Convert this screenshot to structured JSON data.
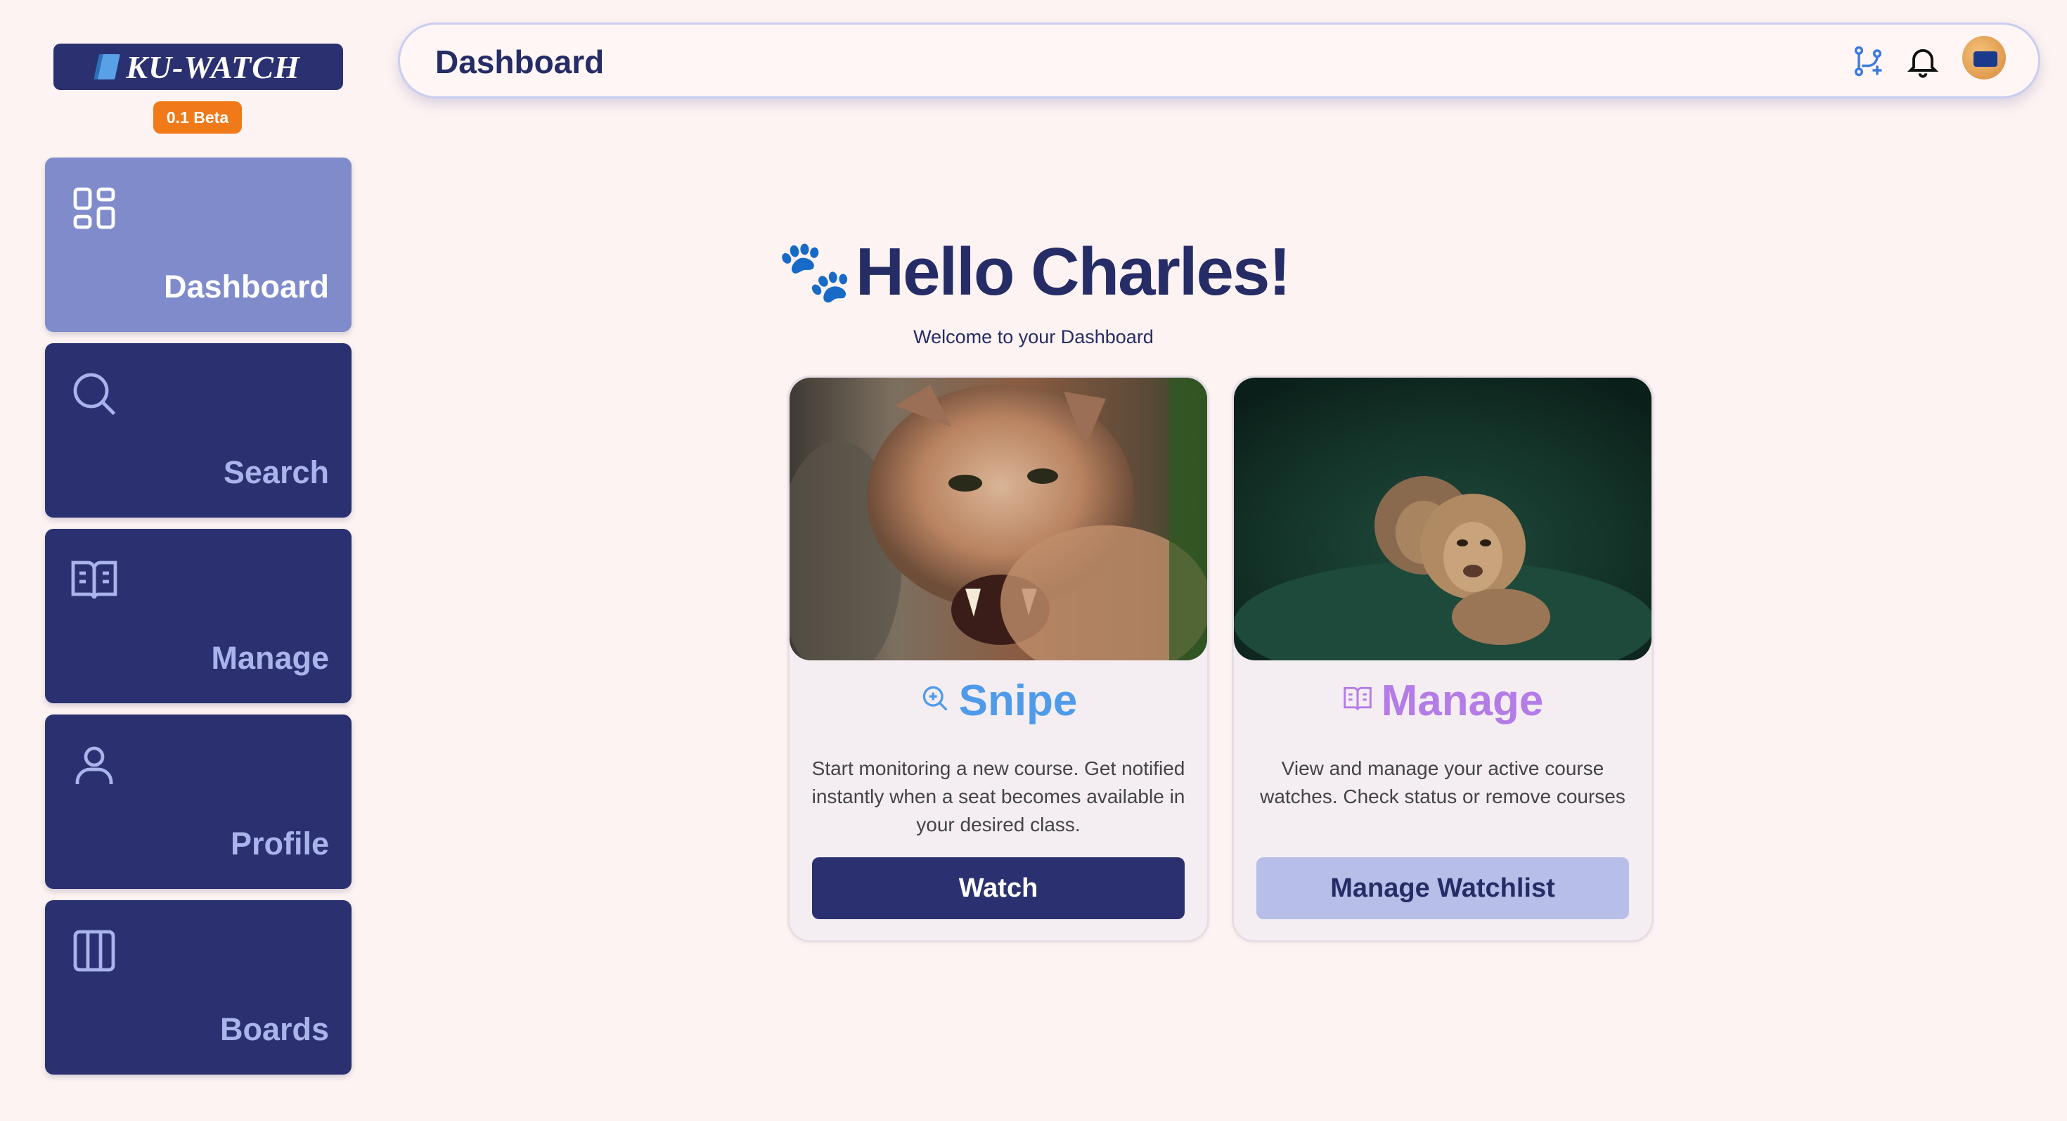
{
  "brand": {
    "name": "KU-WATCH",
    "badge": "0.1 Beta"
  },
  "sidebar": {
    "items": [
      {
        "label": "Dashboard",
        "icon": "dashboard-grid-icon",
        "active": true
      },
      {
        "label": "Search",
        "icon": "search-icon",
        "active": false
      },
      {
        "label": "Manage",
        "icon": "open-book-icon",
        "active": false
      },
      {
        "label": "Profile",
        "icon": "user-icon",
        "active": false
      },
      {
        "label": "Boards",
        "icon": "columns-icon",
        "active": false
      }
    ]
  },
  "header": {
    "title": "Dashboard",
    "icons": [
      "git-branch-icon",
      "bell-icon",
      "avatar"
    ]
  },
  "greeting": {
    "emoji": "🐾",
    "text": "Hello Charles!",
    "subtitle": "Welcome to your Dashboard"
  },
  "cards": [
    {
      "title": "Snipe",
      "icon": "zoom-in-icon",
      "title_color": "#4f9bea",
      "image": "cougar-photo",
      "description": "Start monitoring a new course. Get notified instantly when a seat becomes available in your desired class.",
      "button": "Watch"
    },
    {
      "title": "Manage",
      "icon": "open-book-icon",
      "title_color": "#b47ce6",
      "image": "lioness-photo",
      "description": "View and manage your active course watches. Check status or remove courses",
      "button": "Manage Watchlist"
    }
  ],
  "colors": {
    "background": "#fdf3f2",
    "sidebar_bg": "#2b3170",
    "sidebar_active": "#7f8bcb",
    "beta_badge": "#f07a1a",
    "primary_button": "#2b3170",
    "secondary_button": "#b7bee8"
  }
}
